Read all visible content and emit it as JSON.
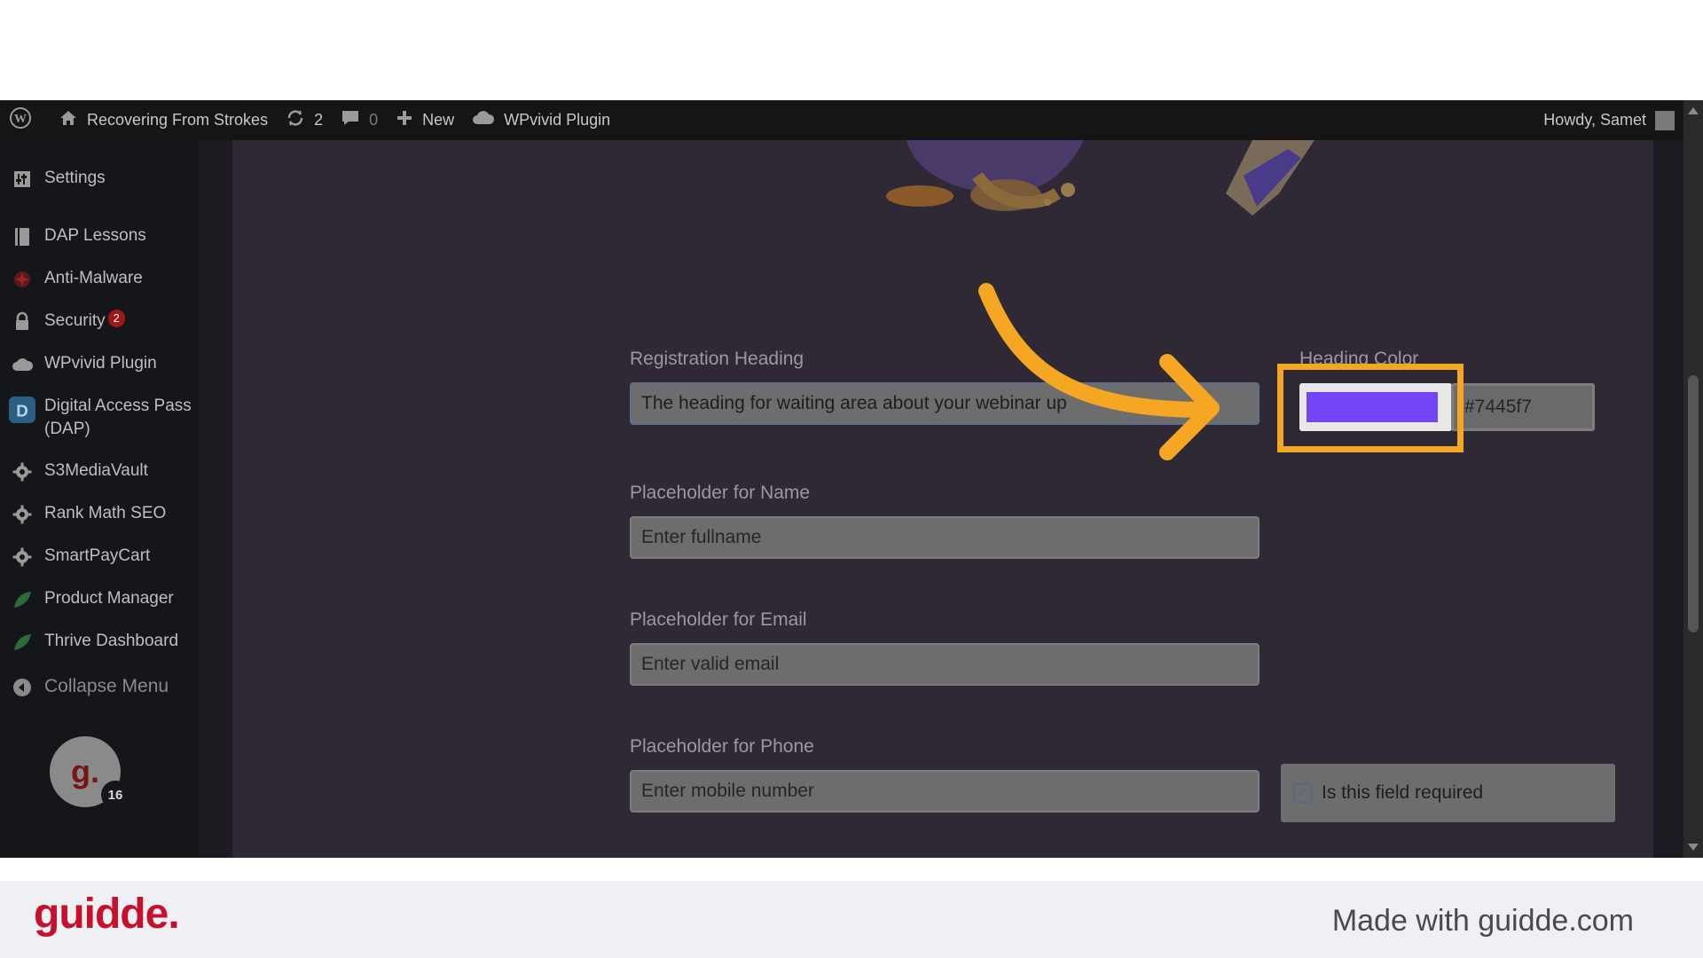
{
  "admin_bar": {
    "site_name": "Recovering From Strokes",
    "updates_count": "2",
    "comments_count": "0",
    "new_label": "New",
    "plugin_label": "WPvivid Plugin",
    "greeting": "Howdy, Samet"
  },
  "sidebar": {
    "items": [
      {
        "label": "Settings",
        "icon": "settings-icon"
      },
      {
        "label": "DAP Lessons",
        "icon": "book-icon"
      },
      {
        "label": "Anti-Malware",
        "icon": "malware-shield-icon"
      },
      {
        "label": "Security",
        "icon": "lock-icon",
        "badge": "2"
      },
      {
        "label": "WPvivid Plugin",
        "icon": "cloud-icon"
      },
      {
        "label": "Digital Access Pass",
        "label2": "(DAP)",
        "icon": "dap-logo-icon"
      },
      {
        "label": "S3MediaVault",
        "icon": "gear-icon"
      },
      {
        "label": "Rank Math SEO",
        "icon": "gear-icon"
      },
      {
        "label": "SmartPayCart",
        "icon": "gear-icon"
      },
      {
        "label": "Product Manager",
        "icon": "leaf-icon"
      },
      {
        "label": "Thrive Dashboard",
        "icon": "leaf-icon"
      }
    ],
    "collapse_label": "Collapse Menu",
    "bubble_letter": "g.",
    "bubble_count": "16"
  },
  "form": {
    "registration_heading": {
      "label": "Registration Heading",
      "value": "The heading for waiting area about your webinar up"
    },
    "heading_color": {
      "label": "Heading Color",
      "color": "#7445f7",
      "hex_value": "#7445f7"
    },
    "name_placeholder": {
      "label": "Placeholder for Name",
      "value": "Enter fullname"
    },
    "email_placeholder": {
      "label": "Placeholder for Email",
      "value": "Enter valid email"
    },
    "phone_placeholder": {
      "label": "Placeholder for Phone",
      "value": "Enter mobile number"
    },
    "required_label": "Is this field required",
    "required_checked": true
  },
  "colors": {
    "accent_arrow": "#f5a623",
    "swatch": "#7445f7",
    "brand_red": "#c8102e"
  },
  "footer": {
    "logo": "guidde.",
    "made_with": "Made with guidde.com"
  }
}
